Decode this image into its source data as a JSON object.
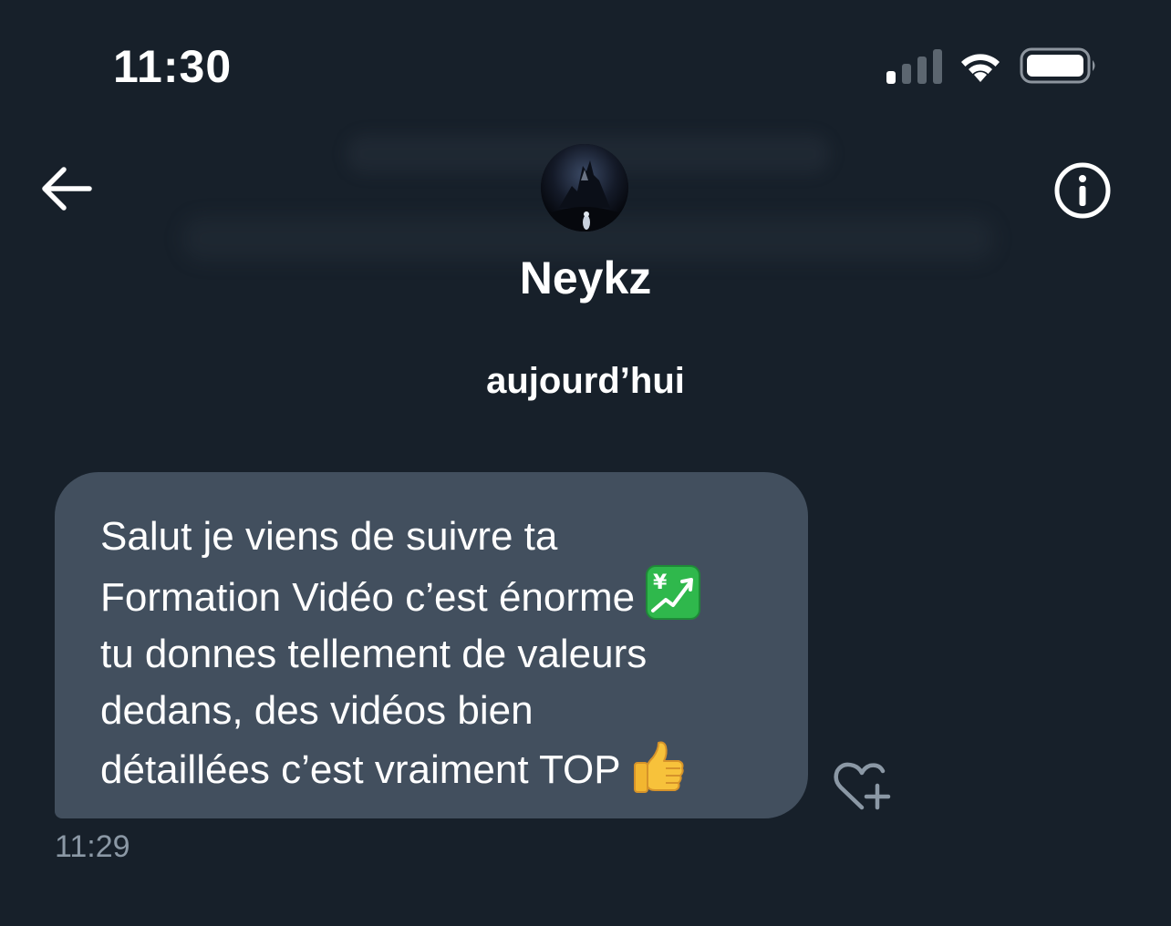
{
  "status_bar": {
    "time": "11:30",
    "signal_icon": "cellular-signal-icon",
    "wifi_icon": "wifi-icon",
    "battery_icon": "battery-icon"
  },
  "header": {
    "back_icon": "arrow-left-icon",
    "info_icon": "info-circle-icon",
    "contact_name": "Neykz"
  },
  "conversation": {
    "date_label": "aujourd’hui",
    "messages": [
      {
        "lines": [
          "Salut je viens de suivre ta",
          "Formation Vidéo c’est énorme",
          "tu donnes tellement de valeurs",
          "dedans, des vidéos bien",
          "détaillées c’est vraiment TOP"
        ],
        "emojis": [
          "chart-increasing-with-yen-emoji",
          "thumbs-up-emoji"
        ],
        "time": "11:29",
        "reaction_icon": "heart-plus-icon"
      }
    ]
  },
  "colors": {
    "background": "#17202a",
    "bubble": "#424f5e",
    "timestamp": "#8b98a5",
    "text": "#ffffff"
  }
}
